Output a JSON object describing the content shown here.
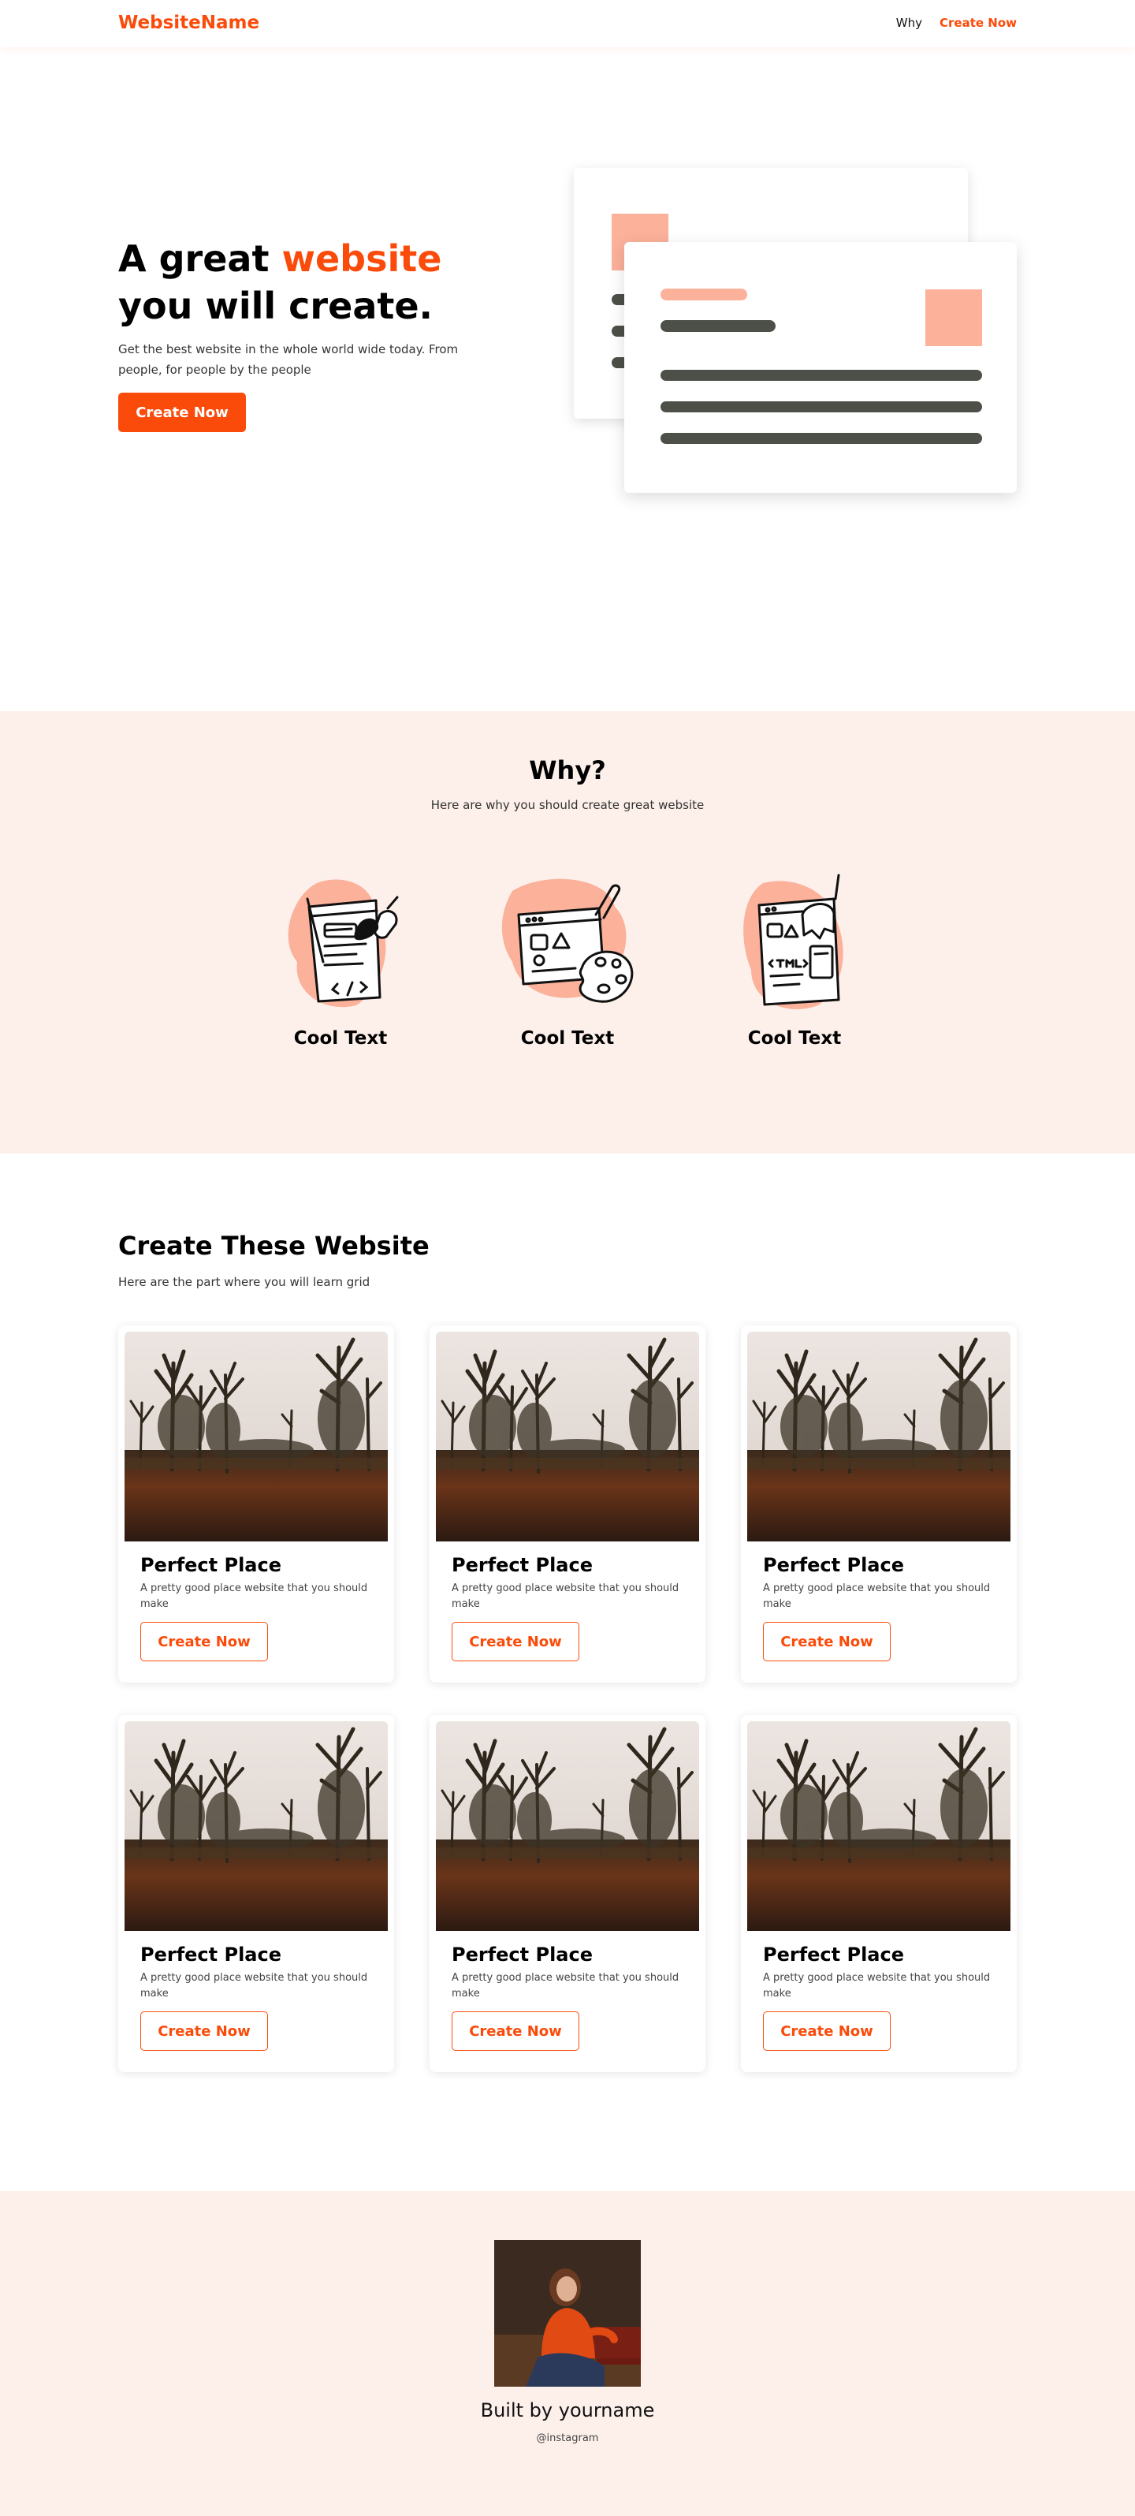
{
  "nav": {
    "brand": "WebsiteName",
    "links": [
      {
        "label": "Why"
      },
      {
        "label": "Create Now"
      }
    ]
  },
  "hero": {
    "title_prefix": "A great ",
    "title_accent": "website",
    "title_line2": "you will create.",
    "description": "Get the best website in the whole world wide today. From people, for people by the people",
    "cta_label": "Create Now"
  },
  "why": {
    "title": "Why?",
    "subtitle": "Here are why you should create great website",
    "features": [
      {
        "label": "Cool Text",
        "icon": "design-tools-icon"
      },
      {
        "label": "Cool Text",
        "icon": "paint-palette-icon"
      },
      {
        "label": "Cool Text",
        "icon": "html-code-icon"
      }
    ]
  },
  "projects": {
    "title": "Create These Website",
    "subtitle": "Here are the part where you will learn grid",
    "cards": [
      {
        "title": "Perfect Place",
        "description": "A pretty good place website that you should make",
        "button": "Create Now"
      },
      {
        "title": "Perfect Place",
        "description": "A pretty good place website that you should make",
        "button": "Create Now"
      },
      {
        "title": "Perfect Place",
        "description": "A pretty good place website that you should make",
        "button": "Create Now"
      },
      {
        "title": "Perfect Place",
        "description": "A pretty good place website that you should make",
        "button": "Create Now"
      },
      {
        "title": "Perfect Place",
        "description": "A pretty good place website that you should make",
        "button": "Create Now"
      },
      {
        "title": "Perfect Place",
        "description": "A pretty good place website that you should make",
        "button": "Create Now"
      }
    ]
  },
  "footer": {
    "name": "Built by yourname",
    "handle": "@instagram"
  },
  "colors": {
    "accent": "#fa4b0a",
    "light_peach": "#fbb19a",
    "section_bg": "#fdf0eb",
    "dark_line": "#4d4f49"
  }
}
